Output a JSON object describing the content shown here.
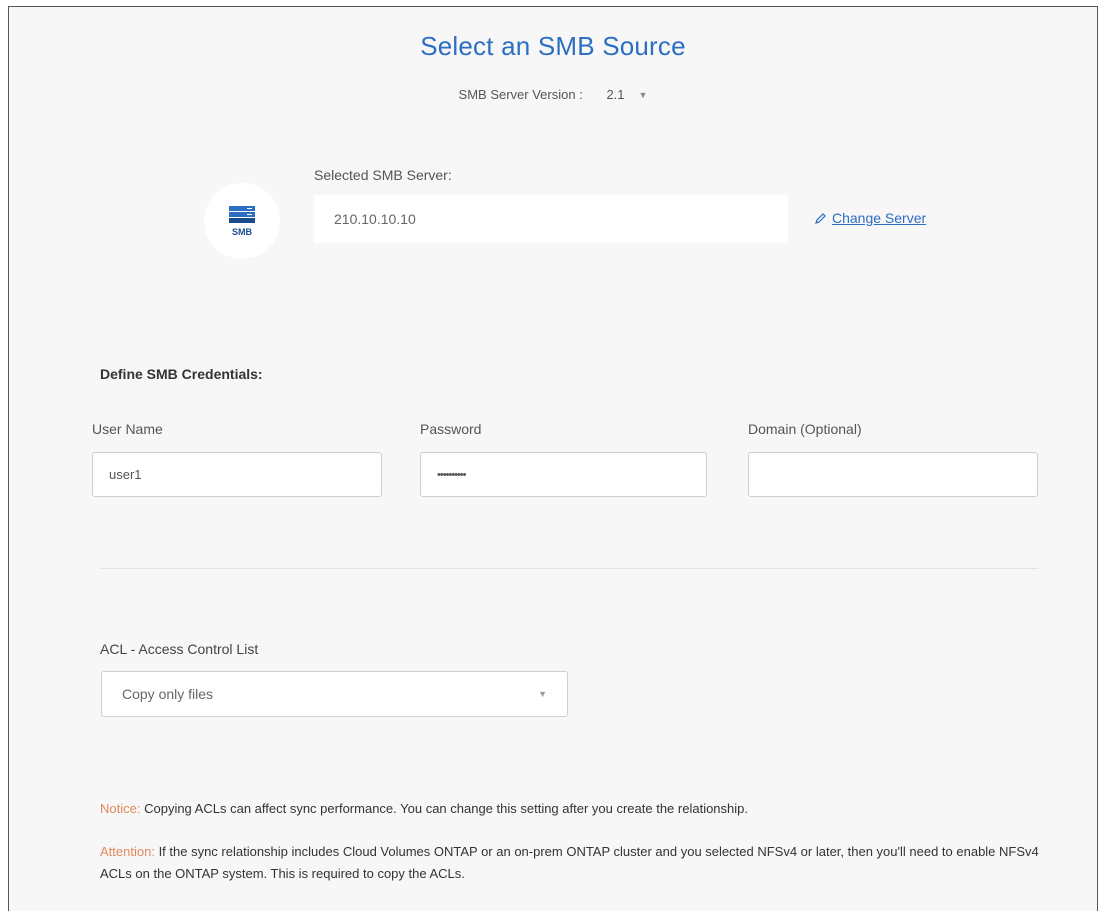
{
  "header": {
    "title": "Select an SMB Source",
    "version_label": "SMB Server Version :",
    "version_value": "2.1"
  },
  "server": {
    "label": "Selected SMB Server:",
    "icon": "server-icon",
    "icon_text": "SMB",
    "value": "210.10.10.10",
    "change_label": "Change Server"
  },
  "credentials": {
    "heading": "Define SMB Credentials:",
    "username_label": "User Name",
    "username_value": "user1",
    "password_label": "Password",
    "password_value": "••••••••••",
    "domain_label": "Domain (Optional)",
    "domain_value": ""
  },
  "acl": {
    "heading": "ACL - Access Control List",
    "selected": "Copy only files"
  },
  "messages": {
    "notice_tag": "Notice:",
    "notice_text": "Copying ACLs can affect sync performance. You can change this setting after you create the relationship.",
    "attention_tag": "Attention:",
    "attention_text": "If the sync relationship includes Cloud Volumes ONTAP or an on-prem ONTAP cluster and you selected NFSv4 or later, then you'll need to enable NFSv4 ACLs on the ONTAP system. This is required to copy the ACLs."
  },
  "colors": {
    "accent": "#2c6ec2",
    "tag": "#e08a5a",
    "background": "#f7f7f7"
  }
}
